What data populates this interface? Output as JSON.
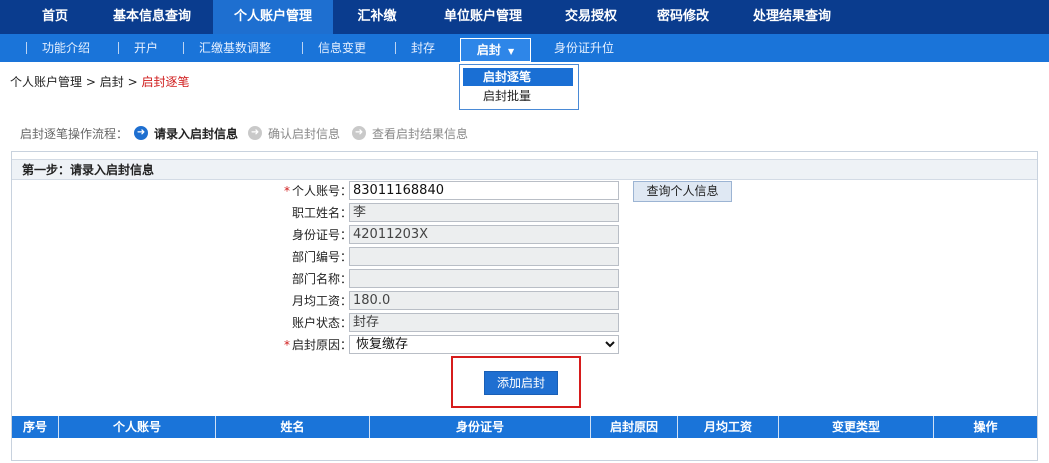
{
  "topnav": {
    "items": [
      "首页",
      "基本信息查询",
      "个人账户管理",
      "汇补缴",
      "单位账户管理",
      "交易授权",
      "密码修改",
      "处理结果查询"
    ],
    "active_index": 2
  },
  "subnav": {
    "items": [
      "功能介绍",
      "开户",
      "汇缴基数调整",
      "信息变更",
      "封存",
      "启封",
      "身份证升位"
    ],
    "active_index": 5
  },
  "dropdown": {
    "items": [
      "启封逐笔",
      "启封批量"
    ],
    "selected_index": 0
  },
  "breadcrumb": {
    "parts": [
      "个人账户管理",
      "启封"
    ],
    "sep": ">",
    "current": "启封逐笔"
  },
  "flow": {
    "label": "启封逐笔操作流程：",
    "steps": [
      "请录入启封信息",
      "确认启封信息",
      "查看启封结果信息"
    ],
    "active_step": 0
  },
  "form": {
    "section_title": "第一步：请录入启封信息",
    "required_mark": "*",
    "fields": [
      {
        "label": "个人账号：",
        "value": "83011168840",
        "required": true
      },
      {
        "label": "职工姓名：",
        "value": "李",
        "required": false
      },
      {
        "label": "身份证号：",
        "value": "42011203X",
        "required": false
      },
      {
        "label": "部门编号：",
        "value": "",
        "required": false
      },
      {
        "label": "部门名称：",
        "value": "",
        "required": false
      },
      {
        "label": "月均工资：",
        "value": "180.0",
        "required": false
      },
      {
        "label": "账户状态：",
        "value": "封存",
        "required": false
      },
      {
        "label": "启封原因：",
        "value": "恢复缴存",
        "required": true
      }
    ],
    "query_button": "查询个人信息",
    "add_button": "添加启封"
  },
  "table": {
    "headers": [
      "序号",
      "个人账号",
      "姓名",
      "身份证号",
      "启封原因",
      "月均工资",
      "变更类型",
      "操作"
    ]
  }
}
